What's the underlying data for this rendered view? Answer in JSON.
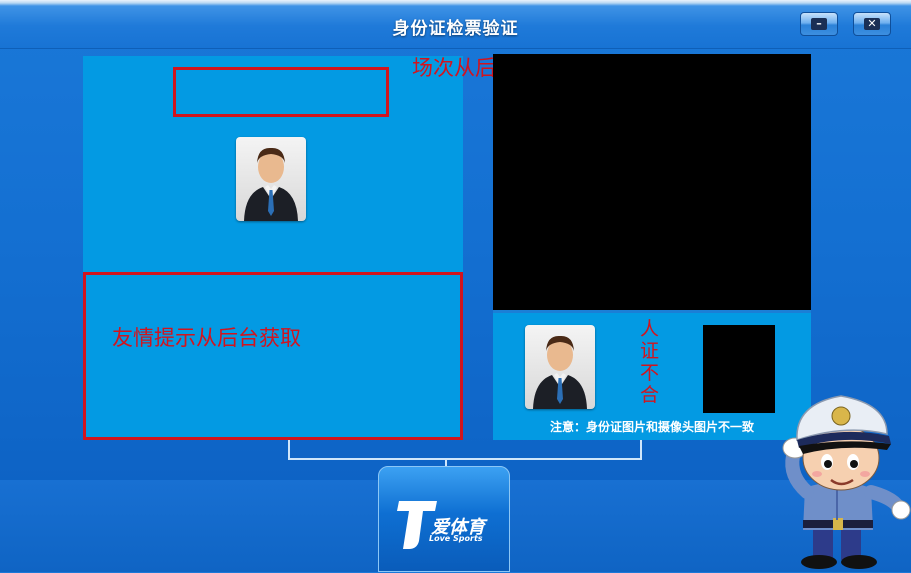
{
  "window": {
    "title": "身份证检票验证",
    "minimize_label": "–",
    "close_label": "✕"
  },
  "left_panel": {
    "session_hint": "场次从后台获取",
    "tip_text": "友情提示从后台获取",
    "avatar_icon": "person-avatar-icon"
  },
  "right_panel": {
    "avatar_icon": "person-avatar-icon",
    "mismatch_label": [
      "人",
      "证",
      "不",
      "合"
    ],
    "notice": "注意：身份证图片和摄像头图片不一致"
  },
  "logo": {
    "brand": "爱体育",
    "sub": "Love Sports",
    "letter": "T"
  },
  "colors": {
    "panel": "#039ae3",
    "alert_red": "#d2141e",
    "background": "#1470d2"
  }
}
